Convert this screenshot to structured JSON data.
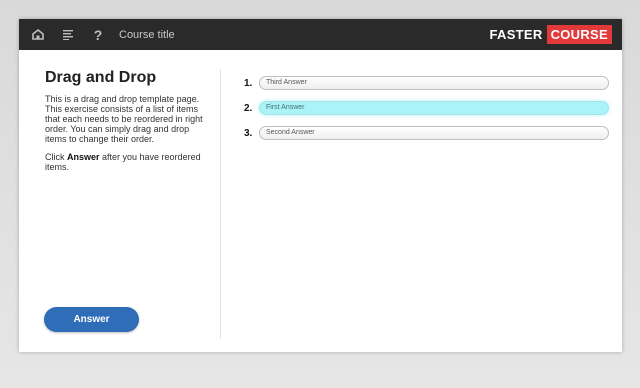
{
  "topbar": {
    "home_icon": "home-icon",
    "menu_icon": "list-menu-icon",
    "help_label": "?",
    "course_title": "Course title",
    "logo_part1": "FASTER",
    "logo_part2": "COURSE",
    "logo_accent": "#e23a3a"
  },
  "intro": {
    "heading": "Drag and Drop",
    "paragraph": "This is a drag and drop template page. This exercise consists of a list of items that each needs to be reordered in right order. You can simply drag and drop items to change their order.",
    "instruction_prefix": "Click ",
    "instruction_bold": "Answer",
    "instruction_suffix": " after you have reordered items."
  },
  "answer_button": {
    "label": "Answer",
    "color": "#2f6db9"
  },
  "items": [
    {
      "number": "1.",
      "label": "Third Answer",
      "active": false
    },
    {
      "number": "2.",
      "label": "First Answer",
      "active": true
    },
    {
      "number": "3.",
      "label": "Second Answer",
      "active": false
    }
  ],
  "colors": {
    "active_item": "#aaf3f6",
    "topbar": "#2a2a2a"
  }
}
